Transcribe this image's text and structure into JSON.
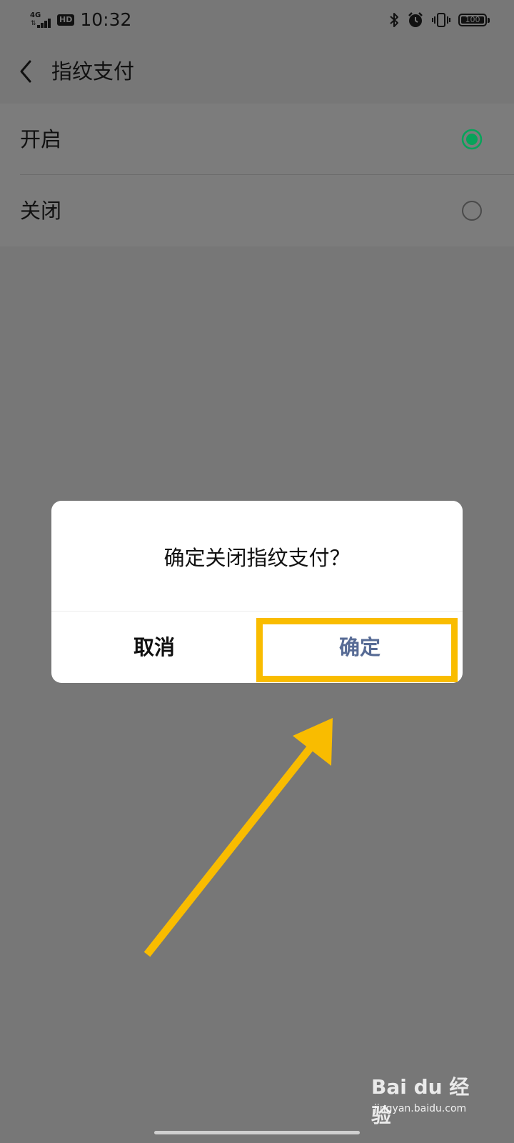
{
  "status_bar": {
    "network": "4G",
    "hd_badge": "HD",
    "time": "10:32",
    "battery": "100",
    "icons": [
      "bluetooth-icon",
      "alarm-icon",
      "vibrate-icon",
      "battery-icon"
    ]
  },
  "header": {
    "title": "指纹支付",
    "back_icon": "chevron-left-icon"
  },
  "options": [
    {
      "label": "开启",
      "selected": true
    },
    {
      "label": "关闭",
      "selected": false
    }
  ],
  "dialog": {
    "message": "确定关闭指纹支付？",
    "cancel_label": "取消",
    "confirm_label": "确定"
  },
  "watermark": {
    "logo_text": "Bai du 经验",
    "url": "jingyan.baidu.com"
  },
  "colors": {
    "accent_green": "#07a35a",
    "dialog_confirm": "#576b95",
    "highlight": "#f9bc00",
    "scrim": "#777777"
  }
}
